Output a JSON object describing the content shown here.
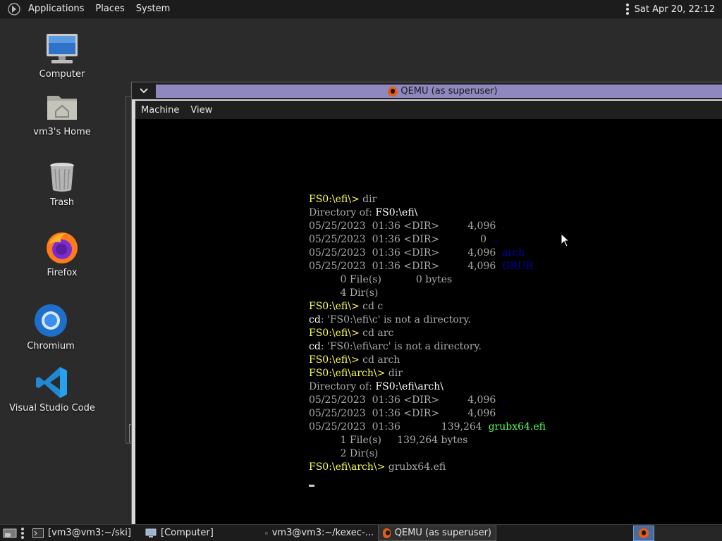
{
  "top_panel": {
    "menus": [
      "Applications",
      "Places",
      "System"
    ],
    "clock": "Sat Apr 20, 22:12"
  },
  "desktop_icons": [
    {
      "label": "Computer",
      "icon": "computer-icon"
    },
    {
      "label": "vm3's Home",
      "icon": "home-folder-icon"
    },
    {
      "label": "Trash",
      "icon": "trash-icon"
    },
    {
      "label": "Firefox",
      "icon": "firefox-icon"
    },
    {
      "label": "Chromium",
      "icon": "chromium-icon"
    },
    {
      "label": "Visual Studio Code",
      "icon": "vscode-icon"
    }
  ],
  "qemu": {
    "title": "QEMU (as superuser)",
    "menus": [
      "Machine",
      "View"
    ],
    "console": [
      [
        {
          "t": "FS0:\\efi\\> ",
          "c": "yellow"
        },
        {
          "t": "dir",
          "c": "gray"
        }
      ],
      [
        {
          "t": "Directory of: ",
          "c": "gray"
        },
        {
          "t": "FS0:\\efi\\",
          "c": "white"
        }
      ],
      [
        {
          "t": "05/25/2023  01:36 <DIR>         4,096  ",
          "c": "gray"
        },
        {
          "t": ".",
          "c": "blue"
        }
      ],
      [
        {
          "t": "05/25/2023  01:36 <DIR>             0  ",
          "c": "gray"
        },
        {
          "t": "..",
          "c": "blue"
        }
      ],
      [
        {
          "t": "05/25/2023  01:36 <DIR>         4,096  ",
          "c": "gray"
        },
        {
          "t": "arch",
          "c": "blue"
        }
      ],
      [
        {
          "t": "05/25/2023  01:36 <DIR>         4,096  ",
          "c": "gray"
        },
        {
          "t": "GRUB",
          "c": "blue"
        }
      ],
      [
        {
          "t": "          0 File(s)           0 bytes",
          "c": "gray"
        }
      ],
      [
        {
          "t": "          4 Dir(s)",
          "c": "gray"
        }
      ],
      [
        {
          "t": "FS0:\\efi\\> ",
          "c": "yellow"
        },
        {
          "t": "cd c",
          "c": "gray"
        }
      ],
      [
        {
          "t": "cd",
          "c": "white"
        },
        {
          "t": ": 'FS0:\\efi\\c' is not a directory.",
          "c": "gray"
        }
      ],
      [
        {
          "t": "FS0:\\efi\\> ",
          "c": "yellow"
        },
        {
          "t": "cd arc",
          "c": "gray"
        }
      ],
      [
        {
          "t": "cd",
          "c": "white"
        },
        {
          "t": ": 'FS0:\\efi\\arc' is not a directory.",
          "c": "gray"
        }
      ],
      [
        {
          "t": "FS0:\\efi\\> ",
          "c": "yellow"
        },
        {
          "t": "cd arch",
          "c": "gray"
        }
      ],
      [
        {
          "t": "FS0:\\efi\\arch\\> ",
          "c": "yellow"
        },
        {
          "t": "dir",
          "c": "gray"
        }
      ],
      [
        {
          "t": "Directory of: ",
          "c": "gray"
        },
        {
          "t": "FS0:\\efi\\arch\\",
          "c": "white"
        }
      ],
      [
        {
          "t": "05/25/2023  01:36 <DIR>         4,096  ",
          "c": "gray"
        },
        {
          "t": ".",
          "c": "blue"
        }
      ],
      [
        {
          "t": "05/25/2023  01:36 <DIR>         4,096  ",
          "c": "gray"
        },
        {
          "t": "..",
          "c": "blue"
        }
      ],
      [
        {
          "t": "05/25/2023  01:36             139,264  ",
          "c": "gray"
        },
        {
          "t": "grubx64.efi",
          "c": "green"
        }
      ],
      [
        {
          "t": "          1 File(s)     139,264 bytes",
          "c": "gray"
        }
      ],
      [
        {
          "t": "          2 Dir(s)",
          "c": "gray"
        }
      ],
      [
        {
          "t": "FS0:\\efi\\arch\\> ",
          "c": "yellow"
        },
        {
          "t": "grubx64.efi",
          "c": "gray"
        }
      ]
    ]
  },
  "taskbar": {
    "tasks": [
      {
        "label": "[vm3@vm3:~/ski]",
        "icon": "terminal-icon"
      },
      {
        "label": "[Computer]",
        "icon": "computer-icon"
      },
      {
        "label": "vm3@vm3:~/kexec-...",
        "icon": "terminal-icon"
      },
      {
        "label": "QEMU (as superuser)",
        "icon": "qemu-icon"
      }
    ]
  },
  "colors": {
    "desktop": "#2b2b2b",
    "panel": "#1c1c1c",
    "qemu_title_strip": "#8e88c0",
    "console_prompt": "#ffff55",
    "console_dir": "#0000aa",
    "console_exec": "#55ff55"
  }
}
